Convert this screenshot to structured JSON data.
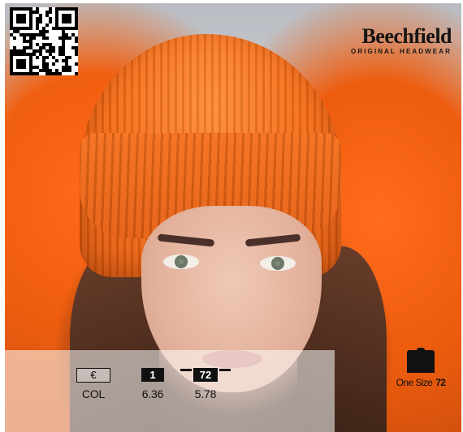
{
  "brand": {
    "name": "Beechfield",
    "tagline": "ORIGINAL HEADWEAR"
  },
  "pricing": {
    "currency_symbol": "€",
    "currency_label": "COL",
    "qty_single_badge": "1",
    "qty_single_price": "6.36",
    "qty_box_badge": "72",
    "qty_box_price": "5.78"
  },
  "size": {
    "label": "One Size",
    "pack_count": "72"
  },
  "colors": {
    "hat_orange": "#f56a14",
    "ink": "#111111"
  },
  "icons": [
    "qr-code-icon",
    "box-icon",
    "hat-size-icon"
  ]
}
